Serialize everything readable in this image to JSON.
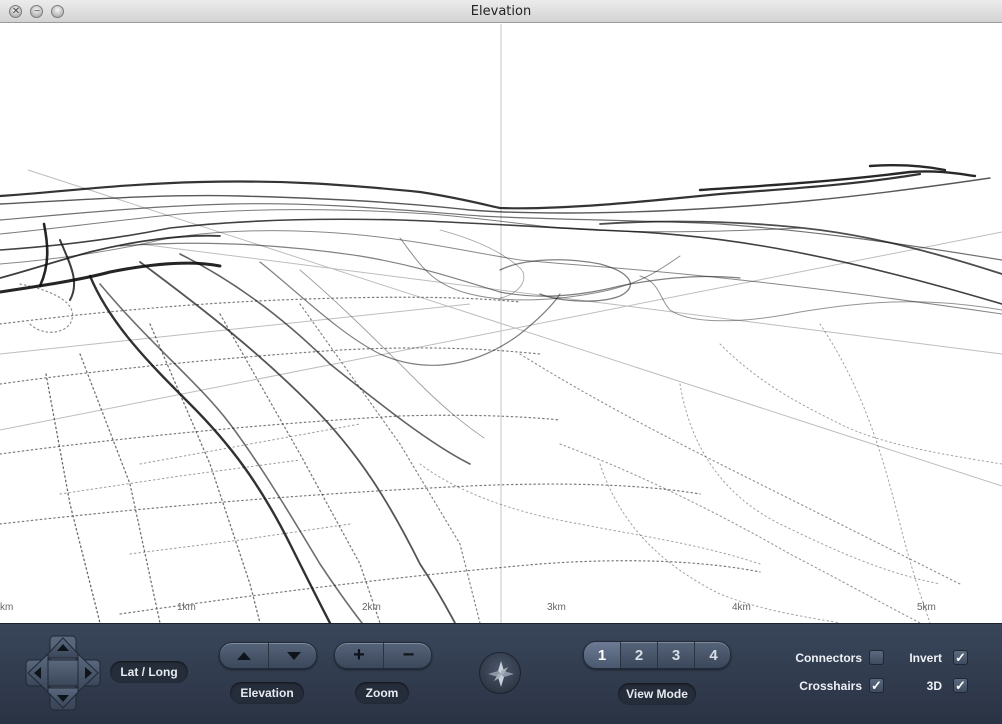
{
  "window": {
    "title": "Elevation"
  },
  "traffic_lights": {
    "close": "✕",
    "minimize": "−",
    "zoom": ""
  },
  "ruler": {
    "ticks": [
      "km",
      "1km",
      "2km",
      "3km",
      "4km",
      "5km"
    ]
  },
  "controls": {
    "latlong_label": "Lat / Long",
    "elevation_label": "Elevation",
    "zoom_label": "Zoom",
    "zoom_in": "+",
    "zoom_out": "−",
    "view_mode_label": "View Mode",
    "view_modes": [
      "1",
      "2",
      "3",
      "4"
    ],
    "active_view_mode": "1"
  },
  "options": {
    "connectors": {
      "label": "Connectors",
      "checked": false
    },
    "invert": {
      "label": "Invert",
      "checked": true
    },
    "crosshairs": {
      "label": "Crosshairs",
      "checked": true
    },
    "three_d": {
      "label": "3D",
      "checked": true
    }
  },
  "icons": {
    "dpad": "dpad-icon",
    "compass": "compass-icon",
    "elevation_up": "triangle-up-icon",
    "elevation_down": "triangle-down-icon",
    "check": "✓"
  }
}
